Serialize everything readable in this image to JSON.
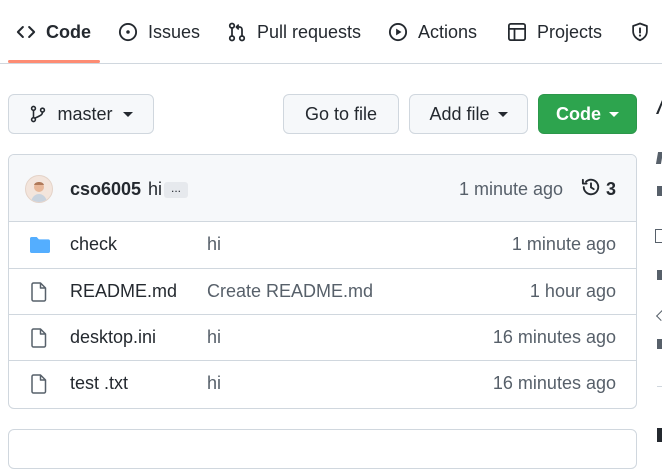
{
  "nav": {
    "tabs": [
      {
        "label": "Code"
      },
      {
        "label": "Issues"
      },
      {
        "label": "Pull requests"
      },
      {
        "label": "Actions"
      },
      {
        "label": "Projects"
      }
    ]
  },
  "toolbar": {
    "branch_label": "master",
    "go_to_file_label": "Go to file",
    "add_file_label": "Add file",
    "code_label": "Code"
  },
  "commit": {
    "author": "cso6005",
    "message": "hi",
    "ellipsis": "...",
    "time": "1 minute ago",
    "count": "3"
  },
  "files": [
    {
      "type": "folder",
      "name": "check",
      "message": "hi",
      "time": "1 minute ago"
    },
    {
      "type": "file",
      "name": "README.md",
      "message": "Create README.md",
      "time": "1 hour ago"
    },
    {
      "type": "file",
      "name": "desktop.ini",
      "message": "hi",
      "time": "16 minutes ago"
    },
    {
      "type": "file",
      "name": "test .txt",
      "message": "hi",
      "time": "16 minutes ago"
    }
  ],
  "colors": {
    "accent_underline": "#fd8c73",
    "code_button": "#2da44e",
    "folder_icon": "#54aeff",
    "border": "#d0d7de"
  }
}
